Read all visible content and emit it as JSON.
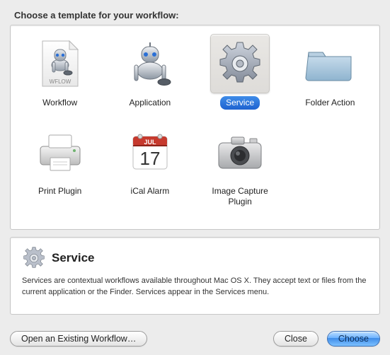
{
  "heading": "Choose a template for your workflow:",
  "templates": {
    "workflow": {
      "label": "Workflow"
    },
    "application": {
      "label": "Application"
    },
    "service": {
      "label": "Service"
    },
    "folder_action": {
      "label": "Folder Action"
    },
    "print_plugin": {
      "label": "Print Plugin"
    },
    "ical_alarm": {
      "label": "iCal Alarm"
    },
    "image_capture": {
      "label": "Image Capture Plugin"
    }
  },
  "selected_template": "service",
  "detail": {
    "title": "Service",
    "description": "Services are contextual workflows available throughout Mac OS X. They accept text or files from the current application or the Finder. Services appear in the Services menu."
  },
  "buttons": {
    "open_existing": "Open an Existing Workflow…",
    "close": "Close",
    "choose": "Choose"
  }
}
